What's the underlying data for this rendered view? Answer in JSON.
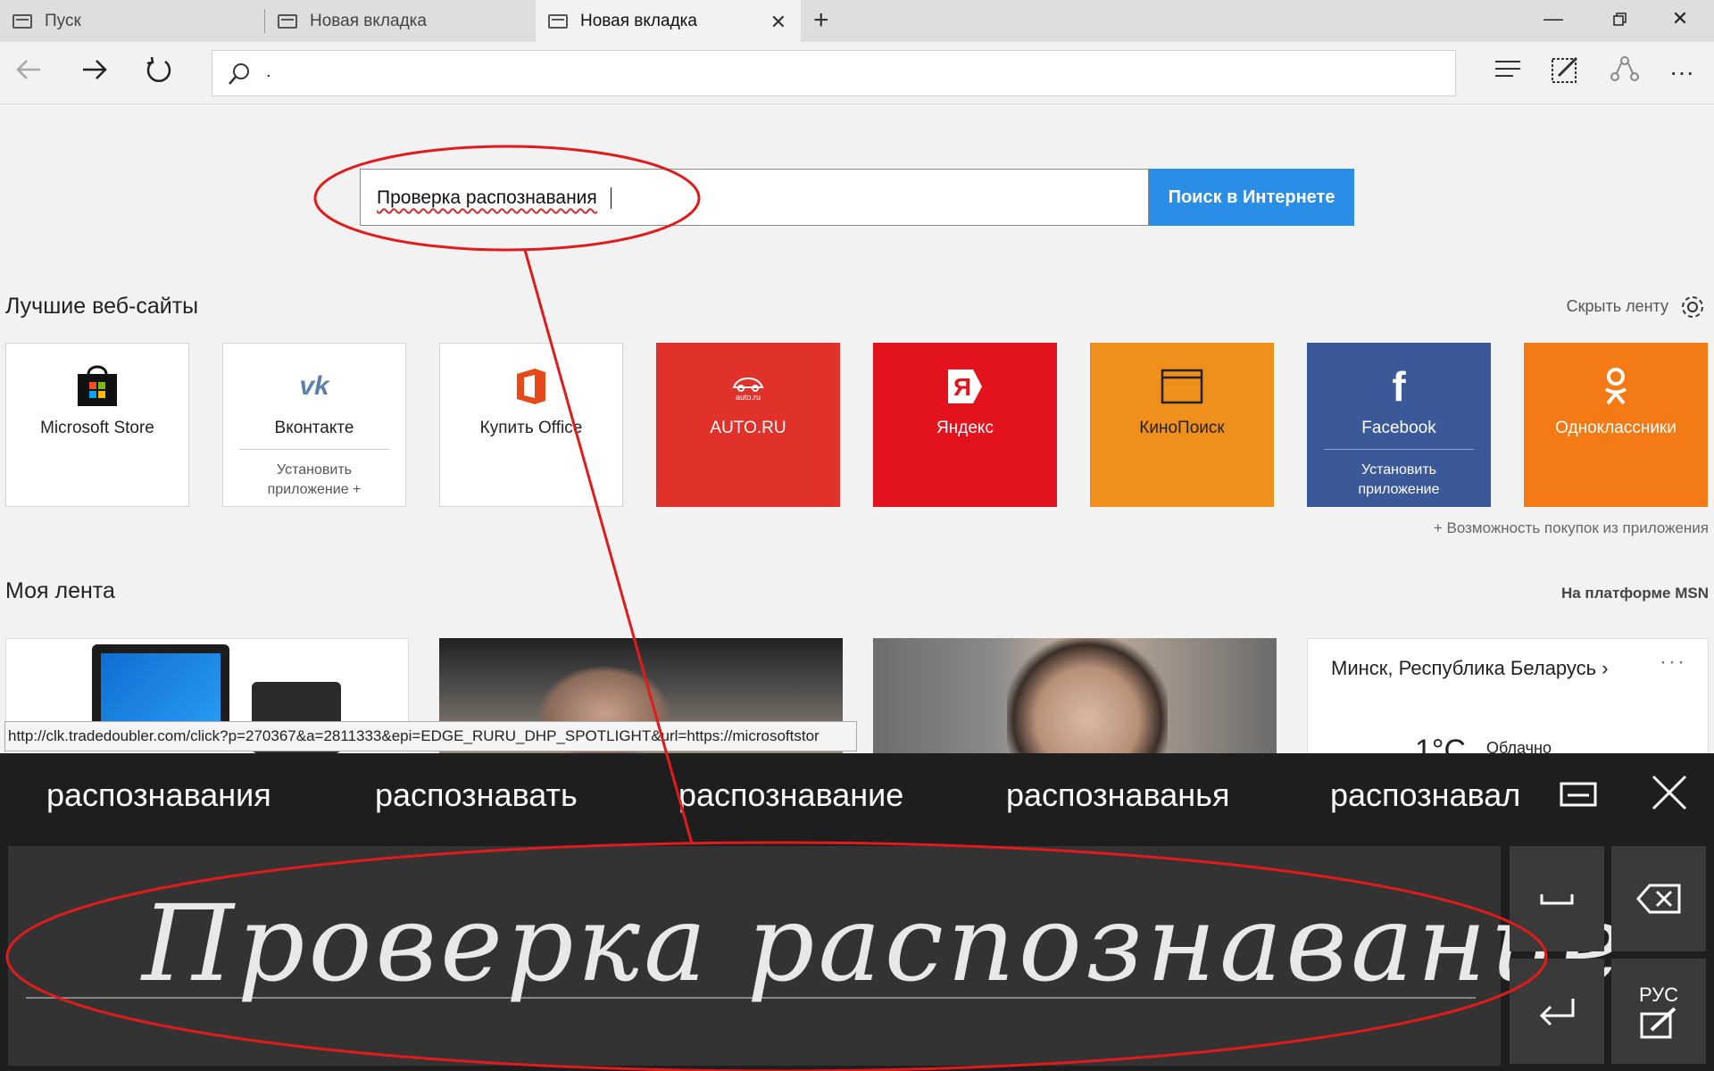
{
  "tabs": [
    {
      "label": "Пуск"
    },
    {
      "label": "Новая вкладка"
    },
    {
      "label": "Новая вкладка"
    }
  ],
  "address": {
    "value": "."
  },
  "search": {
    "value": "Проверка распознавания",
    "button_label": "Поиск в Интернете"
  },
  "top_sites": {
    "title": "Лучшие веб-сайты",
    "hide_label": "Скрыть ленту",
    "purchase_note": "+ Возможность покупок из приложения",
    "tiles": [
      {
        "label": "Microsoft Store",
        "sub": "",
        "color": "#ffffff"
      },
      {
        "label": "Вконтакте",
        "sub": "Установить приложение +",
        "color": "#ffffff"
      },
      {
        "label": "Купить Office",
        "sub": "",
        "color": "#ffffff"
      },
      {
        "label": "AUTO.RU",
        "sub": "",
        "color": "#e0312a",
        "icon_text": "auto.ru"
      },
      {
        "label": "Яндекс",
        "sub": "",
        "color": "#e3131e",
        "icon_text": "Я"
      },
      {
        "label": "КиноПоиск",
        "sub": "",
        "color": "#f0901c"
      },
      {
        "label": "Facebook",
        "sub": "Установить приложение",
        "color": "#3b5998",
        "icon_text": "f"
      },
      {
        "label": "Одноклассники",
        "sub": "",
        "color": "#f37a15"
      }
    ]
  },
  "feed": {
    "title": "Моя лента",
    "platform_label": "На платформе MSN",
    "weather": {
      "city": "Минск, Республика Беларусь ›",
      "more": "···",
      "temp": "1°C",
      "condition": "Облачно"
    }
  },
  "status_url": "http://clk.tradedoubler.com/click?p=270367&a=2811333&epi=EDGE_RURU_DHP_SPOTLIGHT&url=https://microsoftstor",
  "handwriting": {
    "candidates": [
      "распознавания",
      "распознавать",
      "распознавание",
      "распознаванья",
      "распознавал"
    ],
    "ink_text": "Проверка распознавание",
    "lang_label": "РУС"
  },
  "colors": {
    "accent": "#2b8ee6",
    "annotation": "#e01b1b",
    "panel": "#1e1e1e"
  }
}
